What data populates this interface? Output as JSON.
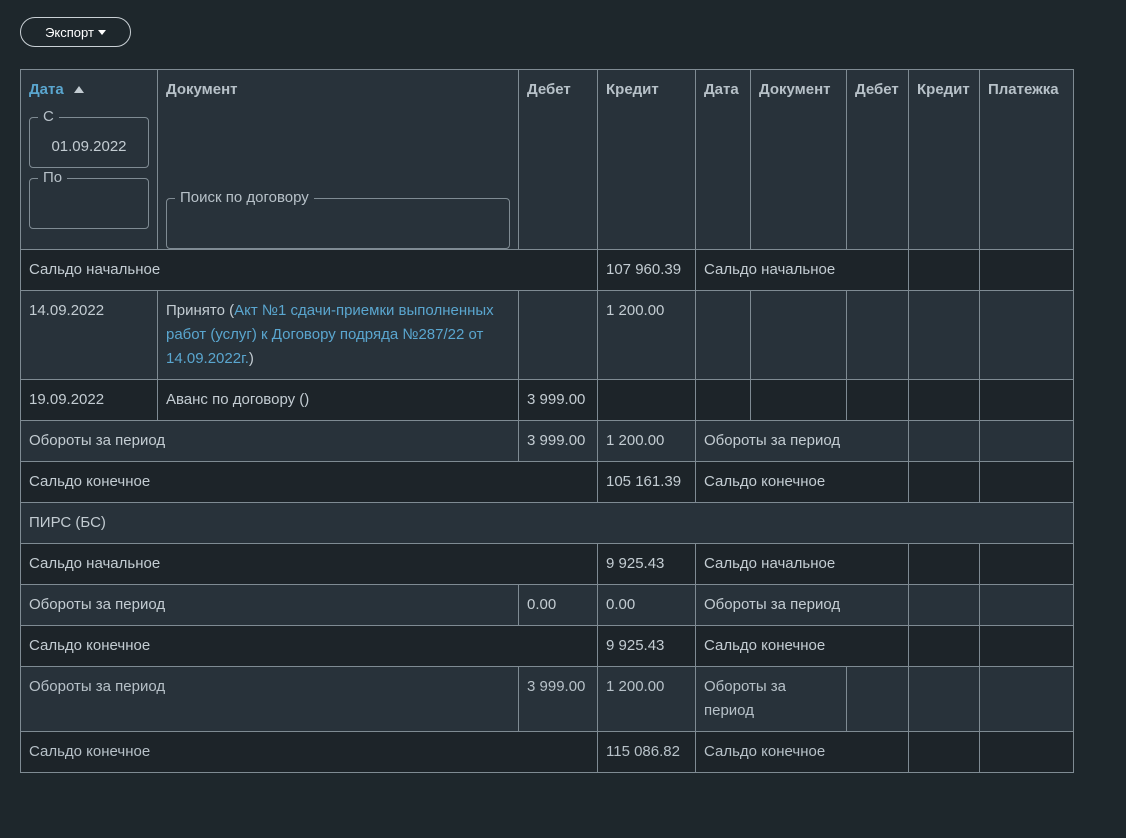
{
  "toolbar": {
    "export_label": "Экспорт"
  },
  "headers": {
    "date": "Дата",
    "document": "Документ",
    "debit": "Дебет",
    "credit": "Кредит",
    "date2": "Дата",
    "document2": "Документ",
    "debit2": "Дебет",
    "credit2": "Кредит",
    "payment": "Платежка"
  },
  "filters": {
    "from_label": "С",
    "from_value": "01.09.2022",
    "to_label": "По",
    "to_value": "",
    "search_label": "Поиск по договору"
  },
  "section1": {
    "opening": {
      "label": "Сальдо начальное",
      "credit": "107 960.39",
      "right_label": "Сальдо начальное"
    },
    "rows": [
      {
        "date": "14.09.2022",
        "doc_prefix": "Принято (",
        "doc_link": "Акт №1 сдачи-приемки выполненных работ (услуг) к Договору подряда №287/22 от 14.09.2022г.",
        "doc_suffix": ")",
        "debit": "",
        "credit": "1 200.00"
      },
      {
        "date": "19.09.2022",
        "doc": "Аванс по договору ()",
        "debit": "3 999.00",
        "credit": ""
      }
    ],
    "turnover": {
      "label": "Обороты за период",
      "debit": "3 999.00",
      "credit": "1 200.00",
      "right_label": "Обороты за период"
    },
    "closing": {
      "label": "Сальдо конечное",
      "credit": "105 161.39",
      "right_label": "Сальдо конечное"
    }
  },
  "section2": {
    "title": "ПИРС (БС)",
    "opening": {
      "label": "Сальдо начальное",
      "credit": "9 925.43",
      "right_label": "Сальдо начальное"
    },
    "turnover": {
      "label": "Обороты за период",
      "debit": "0.00",
      "credit": "0.00",
      "right_label": "Обороты за период"
    },
    "closing": {
      "label": "Сальдо конечное",
      "credit": "9 925.43",
      "right_label": "Сальдо конечное"
    }
  },
  "totals": {
    "turnover": {
      "label": "Обороты за период",
      "debit": "3 999.00",
      "credit": "1 200.00",
      "right_label": "Обороты за период"
    },
    "closing": {
      "label": "Сальдо конечное",
      "credit": "115 086.82",
      "right_label": "Сальдо конечное"
    }
  }
}
